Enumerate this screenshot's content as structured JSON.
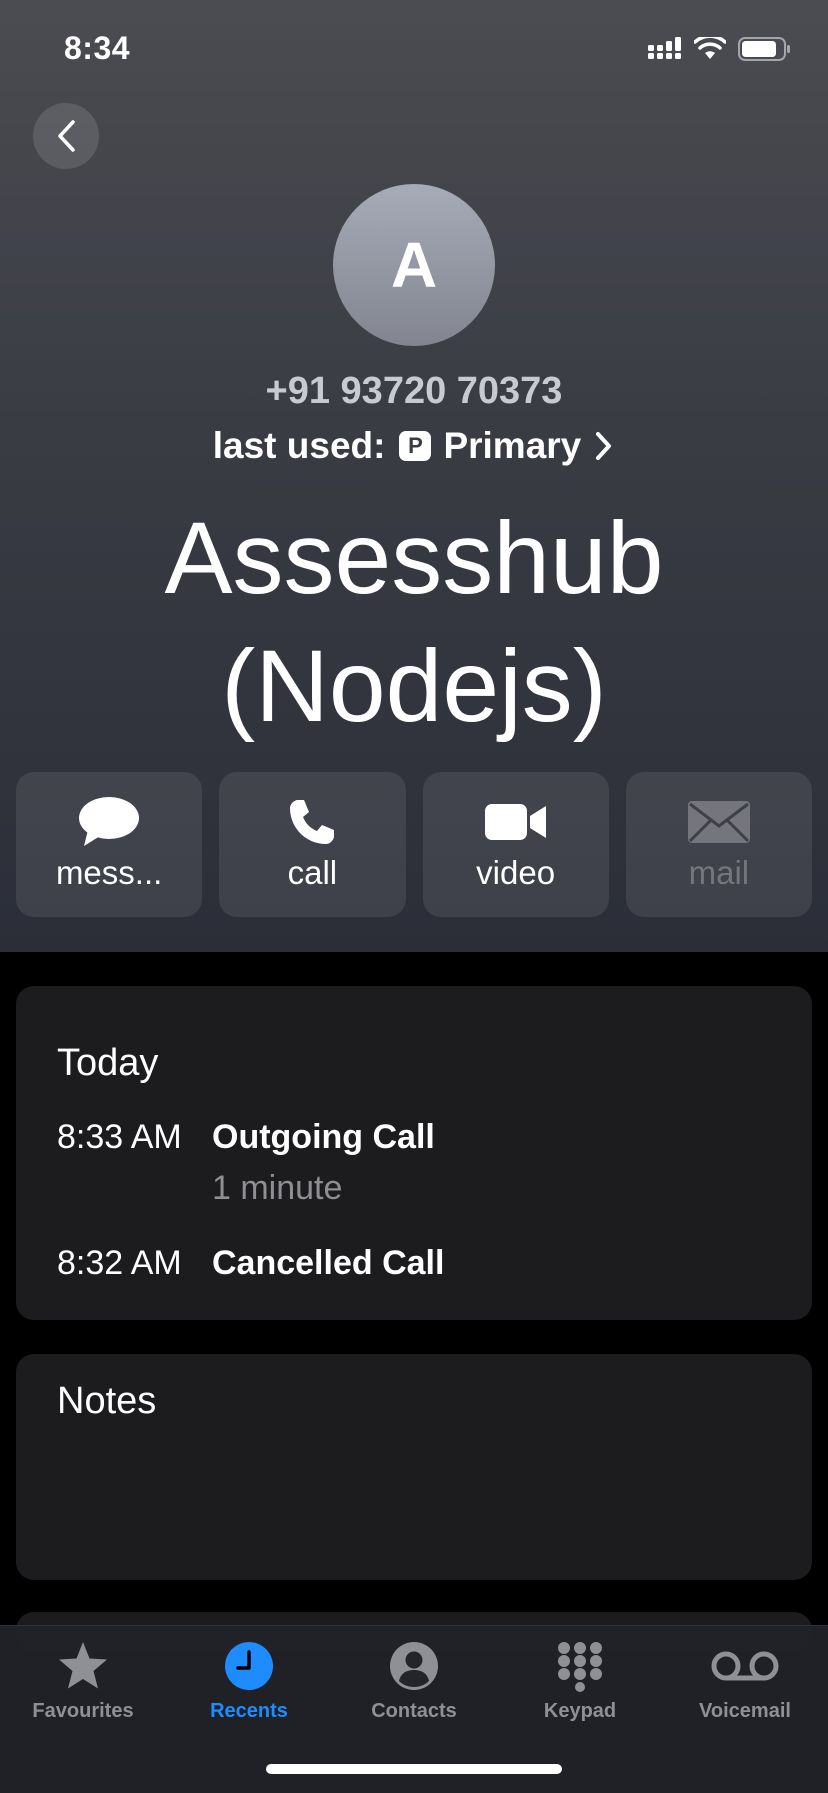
{
  "status_bar": {
    "time": "8:34"
  },
  "contact": {
    "avatar_initial": "A",
    "phone": "+91 93720 70373",
    "last_used_label": "last used:",
    "sim_badge": "P",
    "sim_name": "Primary",
    "name_line1": "Assesshub",
    "name_line2": "(Nodejs)"
  },
  "actions": [
    {
      "label": "mess...",
      "icon": "message-icon",
      "enabled": true
    },
    {
      "label": "call",
      "icon": "phone-icon",
      "enabled": true
    },
    {
      "label": "video",
      "icon": "video-icon",
      "enabled": true
    },
    {
      "label": "mail",
      "icon": "mail-icon",
      "enabled": false
    }
  ],
  "recents": {
    "title": "Today",
    "items": [
      {
        "time": "8:33 AM",
        "type": "Outgoing Call",
        "detail": "1 minute"
      },
      {
        "time": "8:32 AM",
        "type": "Cancelled Call"
      }
    ]
  },
  "notes": {
    "title": "Notes"
  },
  "tabbar": {
    "active": "Recents",
    "accent": "#1e8cff",
    "tabs": [
      {
        "label": "Favourites",
        "icon": "star-icon"
      },
      {
        "label": "Recents",
        "icon": "clock-icon"
      },
      {
        "label": "Contacts",
        "icon": "person-icon"
      },
      {
        "label": "Keypad",
        "icon": "keypad-icon"
      },
      {
        "label": "Voicemail",
        "icon": "voicemail-icon"
      }
    ]
  }
}
